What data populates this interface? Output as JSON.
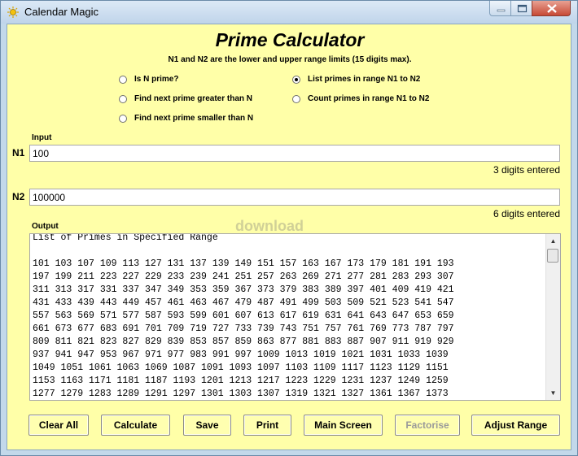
{
  "window": {
    "title": "Calendar Magic",
    "icon": "sun-icon"
  },
  "header": {
    "title": "Prime Calculator",
    "subtitle": "N1 and N2 are the lower and upper range limits (15 digits max)."
  },
  "options": [
    {
      "label": "Is N prime?",
      "selected": false
    },
    {
      "label": "Find next prime greater than N",
      "selected": false
    },
    {
      "label": "Find next prime smaller than N",
      "selected": false
    },
    {
      "label": "List primes in range N1 to N2",
      "selected": true
    },
    {
      "label": "Count primes in range N1 to N2",
      "selected": false
    }
  ],
  "input": {
    "section_label": "Input",
    "n1": {
      "label": "N1",
      "value": "100",
      "status": "3 digits entered"
    },
    "n2": {
      "label": "N2",
      "value": "100000",
      "status": "6 digits entered"
    }
  },
  "output": {
    "label": "Output",
    "lines": [
      "List of Primes in Specified Range",
      "",
      "101 103 107 109 113 127 131 137 139 149 151 157 163 167 173 179 181 191 193",
      "197 199 211 223 227 229 233 239 241 251 257 263 269 271 277 281 283 293 307",
      "311 313 317 331 337 347 349 353 359 367 373 379 383 389 397 401 409 419 421",
      "431 433 439 443 449 457 461 463 467 479 487 491 499 503 509 521 523 541 547",
      "557 563 569 571 577 587 593 599 601 607 613 617 619 631 641 643 647 653 659",
      "661 673 677 683 691 701 709 719 727 733 739 743 751 757 761 769 773 787 797",
      "809 811 821 823 827 829 839 853 857 859 863 877 881 883 887 907 911 919 929",
      "937 941 947 953 967 971 977 983 991 997 1009 1013 1019 1021 1031 1033 1039",
      "1049 1051 1061 1063 1069 1087 1091 1093 1097 1103 1109 1117 1123 1129 1151",
      "1153 1163 1171 1181 1187 1193 1201 1213 1217 1223 1229 1231 1237 1249 1259",
      "1277 1279 1283 1289 1291 1297 1301 1303 1307 1319 1321 1327 1361 1367 1373"
    ]
  },
  "buttons": {
    "clear_all": "Clear All",
    "calculate": "Calculate",
    "save": "Save",
    "print": "Print",
    "main_screen": "Main Screen",
    "factorise": "Factorise",
    "adjust_range": "Adjust Range"
  },
  "watermark": "download"
}
